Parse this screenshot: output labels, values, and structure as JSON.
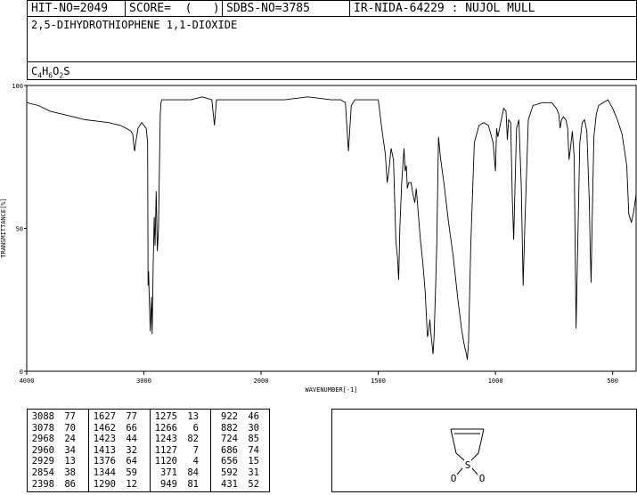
{
  "header": {
    "hit_no": "HIT-NO=2049",
    "score": "SCORE=  (   )",
    "sdbs_no": "SDBS-NO=3785",
    "ir_info": "IR-NIDA-64229 : NUJOL MULL",
    "compound_name": "2,5-DIHYDROTHIOPHENE 1,1-DIOXIDE",
    "formula_parts": [
      {
        "t": "C",
        "sub": false
      },
      {
        "t": "4",
        "sub": true
      },
      {
        "t": "H",
        "sub": false
      },
      {
        "t": "6",
        "sub": true
      },
      {
        "t": "O",
        "sub": false
      },
      {
        "t": "2",
        "sub": true
      },
      {
        "t": "S",
        "sub": false
      }
    ]
  },
  "structure": {
    "atom_s": "S",
    "atom_o1": "O",
    "atom_o2": "O"
  },
  "peak_table": [
    [
      [
        "3088",
        "77"
      ],
      [
        "3078",
        "70"
      ],
      [
        "2968",
        "24"
      ],
      [
        "2960",
        "34"
      ],
      [
        "2929",
        "13"
      ],
      [
        "2854",
        "38"
      ],
      [
        "2398",
        "86"
      ]
    ],
    [
      [
        "1627",
        "77"
      ],
      [
        "1462",
        "66"
      ],
      [
        "1423",
        "44"
      ],
      [
        "1413",
        "32"
      ],
      [
        "1376",
        "64"
      ],
      [
        "1344",
        "59"
      ],
      [
        "1290",
        "12"
      ]
    ],
    [
      [
        "1275",
        "13"
      ],
      [
        "1266",
        "6"
      ],
      [
        "1243",
        "82"
      ],
      [
        "1127",
        "7"
      ],
      [
        "1120",
        "4"
      ],
      [
        "371",
        "84"
      ],
      [
        "949",
        "81"
      ]
    ],
    [
      [
        "922",
        "46"
      ],
      [
        "882",
        "30"
      ],
      [
        "724",
        "85"
      ],
      [
        "686",
        "74"
      ],
      [
        "656",
        "15"
      ],
      [
        "592",
        "31"
      ],
      [
        "431",
        "52"
      ]
    ]
  ],
  "chart_data": {
    "type": "line",
    "xlabel": "WAVENUMBER[-1]",
    "ylabel": "TRANSMITTANCE[%]",
    "x_ticks": [
      "4000",
      "3000",
      "2000",
      "1500",
      "1000",
      "500"
    ],
    "x_tick_values": [
      4000,
      3000,
      2000,
      1500,
      1000,
      500
    ],
    "y_ticks": [
      "0",
      "50",
      "100"
    ],
    "y_tick_values": [
      0,
      50,
      100
    ],
    "xlim": [
      4000,
      400
    ],
    "ylim": [
      0,
      100
    ],
    "x_axis_note": "axis is piecewise linear: 4000-2000 compressed, 2000-400 expanded",
    "series": [
      {
        "x": [
          4000,
          3900,
          3800,
          3700,
          3600,
          3500,
          3400,
          3300,
          3200,
          3150,
          3110,
          3095,
          3088,
          3083,
          3078,
          3070,
          3050,
          3020,
          3000,
          2980,
          2968,
          2964,
          2960,
          2955,
          2945,
          2935,
          2929,
          2920,
          2912,
          2905,
          2895,
          2885,
          2875,
          2860,
          2854,
          2848,
          2840,
          2820,
          2800,
          2700,
          2600,
          2500,
          2420,
          2398,
          2380,
          2300,
          2200,
          2100,
          2000,
          1900,
          1800,
          1700,
          1660,
          1640,
          1627,
          1615,
          1600,
          1560,
          1520,
          1500,
          1485,
          1470,
          1462,
          1455,
          1445,
          1435,
          1425,
          1423,
          1418,
          1413,
          1408,
          1400,
          1390,
          1385,
          1380,
          1376,
          1370,
          1360,
          1352,
          1344,
          1338,
          1330,
          1320,
          1310,
          1300,
          1290,
          1285,
          1280,
          1275,
          1270,
          1266,
          1262,
          1255,
          1250,
          1243,
          1235,
          1220,
          1200,
          1180,
          1160,
          1145,
          1135,
          1127,
          1124,
          1120,
          1115,
          1105,
          1090,
          1070,
          1050,
          1030,
          1010,
          1000,
          995,
          990,
          980,
          965,
          955,
          949,
          944,
          935,
          928,
          922,
          918,
          910,
          900,
          890,
          882,
          875,
          860,
          840,
          800,
          760,
          740,
          730,
          724,
          718,
          710,
          700,
          692,
          686,
          680,
          672,
          664,
          656,
          650,
          640,
          630,
          620,
          610,
          600,
          595,
          592,
          588,
          580,
          570,
          560,
          540,
          520,
          500,
          480,
          460,
          440,
          431,
          420,
          410,
          400
        ],
        "y": [
          94,
          93,
          91,
          90,
          89,
          88,
          87.5,
          87,
          86,
          85,
          84,
          83,
          80,
          78,
          77,
          80,
          85,
          87,
          86,
          85,
          80,
          30,
          35,
          27,
          14,
          26,
          13,
          38,
          54,
          44,
          63,
          42,
          50,
          90,
          94,
          95,
          95,
          95,
          95,
          95,
          95,
          96,
          95,
          86,
          95,
          95,
          95,
          95,
          95,
          95,
          96,
          95,
          95,
          94,
          77,
          93,
          95,
          95,
          95,
          95,
          85,
          76,
          66,
          70,
          78,
          74,
          46,
          44,
          40,
          32,
          50,
          66,
          78,
          70,
          72,
          64,
          66,
          66,
          62,
          59,
          64,
          56,
          46,
          38,
          28,
          12,
          14,
          18,
          13,
          9,
          6,
          12,
          30,
          45,
          82,
          75,
          66,
          52,
          40,
          25,
          15,
          10,
          7,
          6,
          4,
          10,
          45,
          80,
          86,
          87,
          86,
          80,
          70,
          85,
          82,
          86,
          92,
          91,
          81,
          88,
          87,
          60,
          46,
          60,
          85,
          88,
          65,
          30,
          50,
          88,
          93,
          94,
          94,
          92,
          90,
          85,
          88,
          89,
          88,
          85,
          74,
          78,
          84,
          75,
          15,
          40,
          80,
          87,
          88,
          84,
          60,
          40,
          31,
          50,
          82,
          90,
          93,
          94,
          95,
          92,
          88,
          83,
          72,
          55,
          52,
          56,
          62
        ]
      }
    ]
  }
}
